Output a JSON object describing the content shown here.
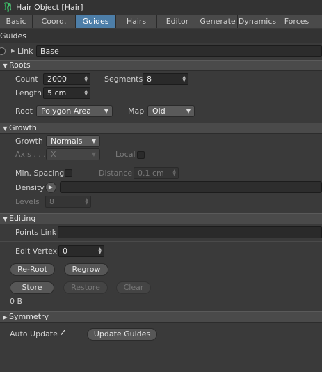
{
  "window": {
    "title": "Hair Object [Hair]"
  },
  "tabs": [
    {
      "label": "Basic"
    },
    {
      "label": "Coord."
    },
    {
      "label": "Guides"
    },
    {
      "label": "Hairs"
    },
    {
      "label": "Editor"
    },
    {
      "label": "Generate"
    },
    {
      "label": "Dynamics"
    },
    {
      "label": "Forces"
    }
  ],
  "active_tab": "Guides",
  "section_title": "Guides",
  "link": {
    "label": "Link",
    "value": "Base"
  },
  "roots": {
    "header": "Roots",
    "count_label": "Count",
    "count_value": "2000",
    "segments_label": "Segments",
    "segments_value": "8",
    "length_label": "Length",
    "length_value": "5 cm",
    "root_label": "Root",
    "root_value": "Polygon Area",
    "map_label": "Map",
    "map_value": "Old"
  },
  "growth": {
    "header": "Growth",
    "growth_label": "Growth",
    "growth_value": "Normals",
    "axis_label": "Axis . . .",
    "axis_value": "X",
    "local_label": "Local",
    "min_spacing_label": "Min. Spacing",
    "distance_label": "Distance",
    "distance_value": "0.1 cm",
    "density_label": "Density",
    "levels_label": "Levels",
    "levels_value": "8"
  },
  "editing": {
    "header": "Editing",
    "points_link_label": "Points Link",
    "edit_vertex_label": "Edit Vertex",
    "edit_vertex_value": "0",
    "reroot_label": "Re-Root",
    "regrow_label": "Regrow",
    "store_label": "Store",
    "restore_label": "Restore",
    "clear_label": "Clear",
    "stored_size": "0 B"
  },
  "symmetry": {
    "header": "Symmetry"
  },
  "footer": {
    "auto_update_label": "Auto Update",
    "auto_update_checked": "✓",
    "update_guides_label": "Update Guides"
  },
  "colors": {
    "active_tab": "#4d7ea8",
    "background": "#3a3a3a"
  }
}
